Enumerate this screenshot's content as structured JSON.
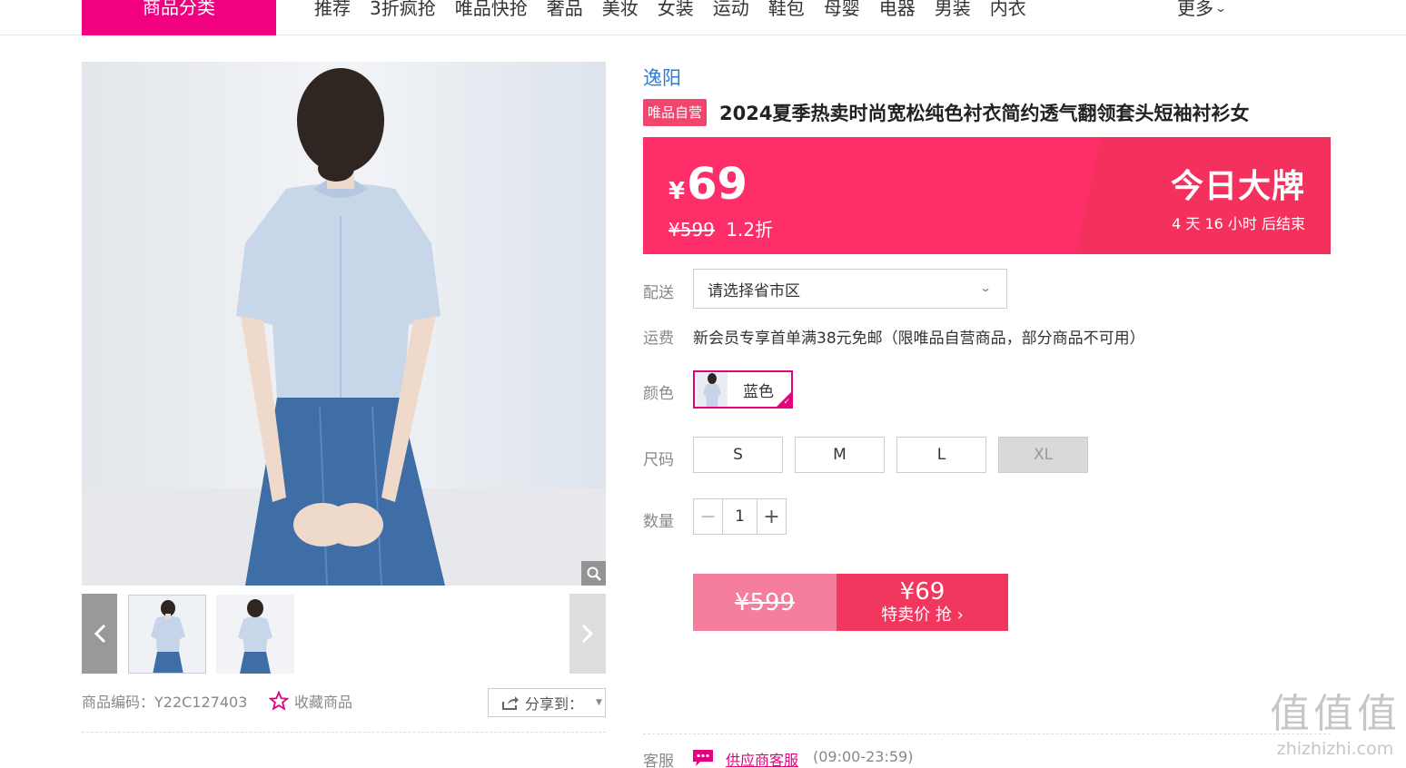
{
  "nav": {
    "category_label": "商品分类",
    "items": [
      "推荐",
      "3折疯抢",
      "唯品快抢",
      "奢品",
      "美妆",
      "女装",
      "运动",
      "鞋包",
      "母婴",
      "电器",
      "男装",
      "内衣"
    ],
    "more_label": "更多"
  },
  "product": {
    "brand": "逸阳",
    "self_tag": "唯品自营",
    "title": "2024夏季热卖时尚宽松纯色衬衣简约透气翻领套头短袖衬衫女",
    "code_label": "商品编码：Y22C127403",
    "favorite_label": "收藏商品",
    "share_label": "分享到："
  },
  "price": {
    "currency": "¥",
    "now": "69",
    "original": "¥599",
    "discount": "1.2折",
    "event_title": "今日大牌",
    "countdown": "4 天 16 小时 后结束"
  },
  "delivery": {
    "label": "配送",
    "placeholder": "请选择省市区"
  },
  "shipping": {
    "label": "运费",
    "text": "新会员专享首单满38元免邮（限唯品自营商品，部分商品不可用）"
  },
  "color": {
    "label": "颜色",
    "selected": "蓝色"
  },
  "size": {
    "label": "尺码",
    "options": [
      "S",
      "M",
      "L",
      "XL"
    ],
    "disabled": [
      "XL"
    ]
  },
  "quantity": {
    "label": "数量",
    "value": "1"
  },
  "buy": {
    "original_price": "¥599",
    "price": "¥69",
    "action": "特卖价 抢"
  },
  "service": {
    "label": "客服",
    "link": "供应商客服",
    "hours": "(09:00-23:59)"
  },
  "watermark": {
    "glyphs": "值值值",
    "domain": "zhizhizhi.com"
  },
  "colors": {
    "brand_pink": "#f10180",
    "banner": "#fe2f68",
    "link_blue": "#2d7bd6"
  }
}
